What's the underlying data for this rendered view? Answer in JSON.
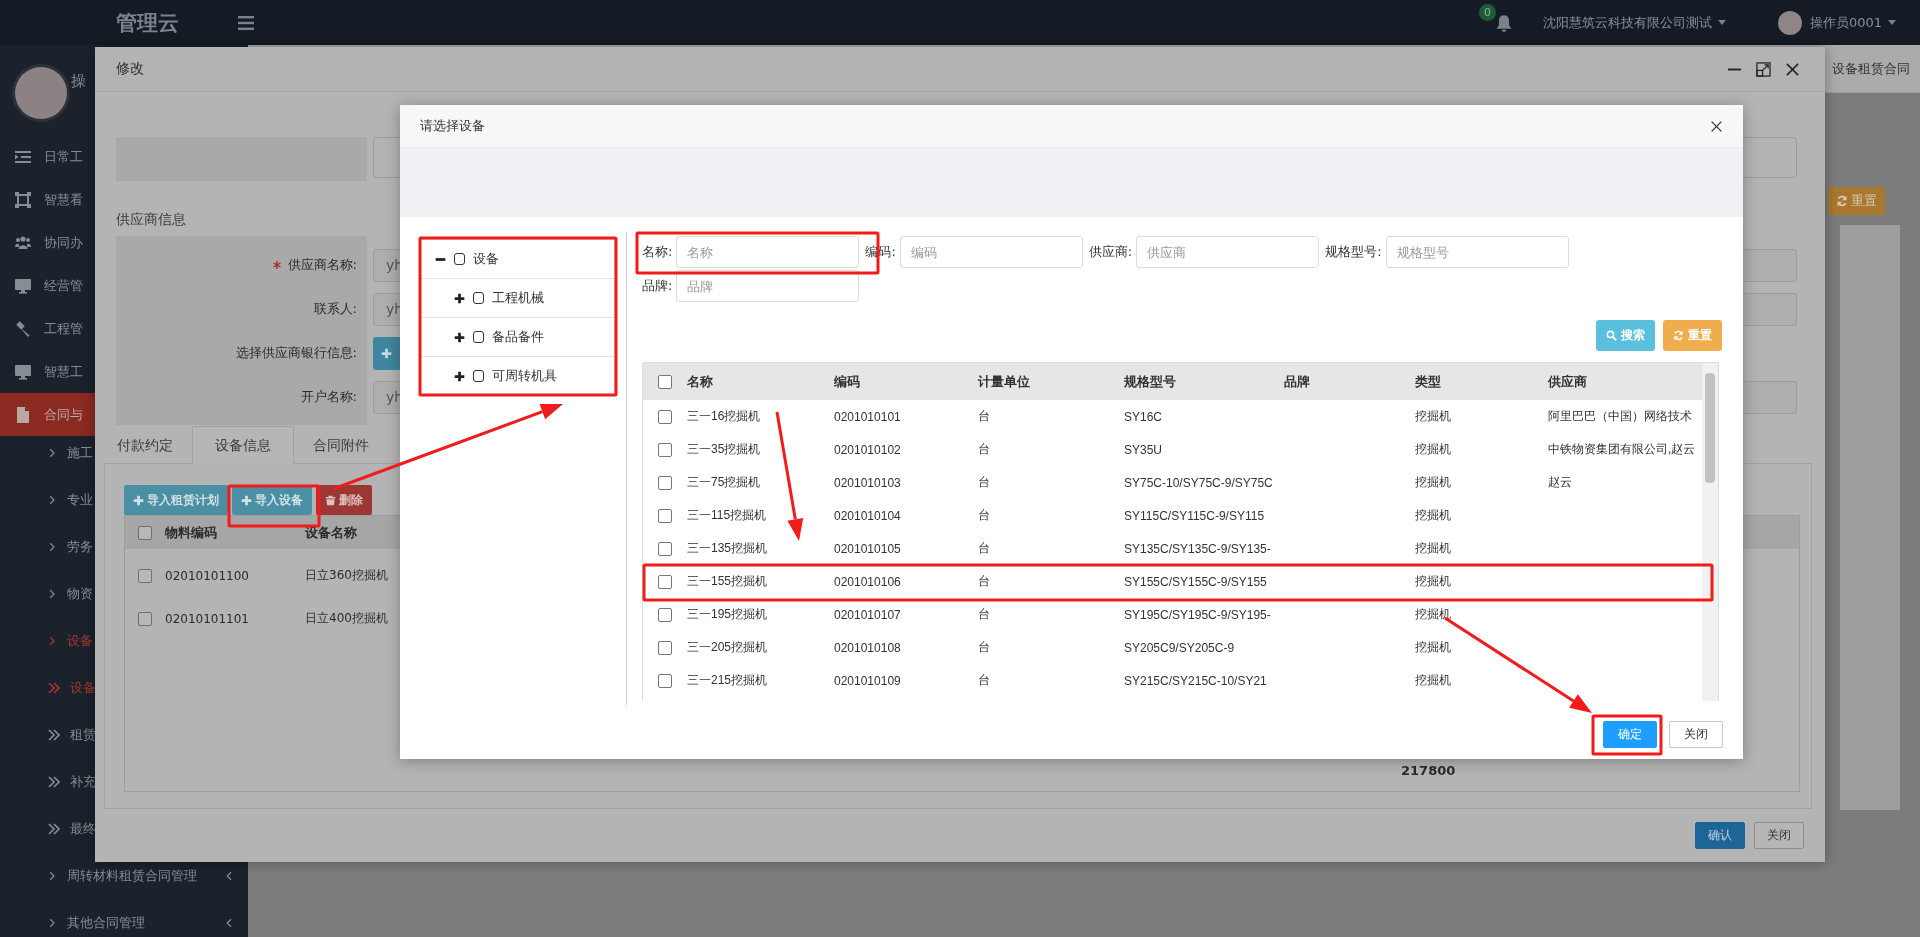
{
  "header": {
    "logo": "管理云",
    "notification_count": "0",
    "company": "沈阳慧筑云科技有限公司测试",
    "user": "操作员0001"
  },
  "sidebar": {
    "user_name": "操",
    "items": [
      {
        "label": "日常工",
        "kind": "section",
        "active": false,
        "collapsible": false
      },
      {
        "label": "智慧看",
        "kind": "section",
        "active": false,
        "collapsible": false
      },
      {
        "label": "协同办",
        "kind": "section",
        "active": false,
        "collapsible": false
      },
      {
        "label": "经营管",
        "kind": "section",
        "active": false,
        "collapsible": false
      },
      {
        "label": "工程管",
        "kind": "section",
        "active": false,
        "collapsible": false
      },
      {
        "label": "智慧工",
        "kind": "section",
        "active": false,
        "collapsible": false
      },
      {
        "label": "合同与",
        "kind": "section",
        "active": true,
        "collapsible": false
      },
      {
        "label": "施工",
        "kind": "link",
        "active": false,
        "collapsible": false
      },
      {
        "label": "专业",
        "kind": "link",
        "active": false,
        "collapsible": false
      },
      {
        "label": "劳务",
        "kind": "link",
        "active": false,
        "collapsible": false
      },
      {
        "label": "物资",
        "kind": "link",
        "active": false,
        "collapsible": false
      },
      {
        "label": "设备",
        "kind": "link",
        "active": true,
        "collapsible": false
      },
      {
        "label": "设备",
        "kind": "sublink",
        "active": true,
        "collapsible": false
      },
      {
        "label": "租赁",
        "kind": "sublink",
        "active": false,
        "collapsible": false
      },
      {
        "label": "补充",
        "kind": "sublink",
        "active": false,
        "collapsible": false
      },
      {
        "label": "最终",
        "kind": "sublink",
        "active": false,
        "collapsible": false
      },
      {
        "label": "周转材料租赁合同管理",
        "kind": "link",
        "active": false,
        "collapsible": true
      },
      {
        "label": "其他合同管理",
        "kind": "link",
        "active": false,
        "collapsible": true
      }
    ]
  },
  "background_page": {
    "tab": "设备租赁合同",
    "reset_button": "重置"
  },
  "edit_dialog": {
    "title": "修改",
    "section_title": "供应商信息",
    "fields": [
      {
        "label": "供应商名称:",
        "required": true,
        "kind": "input",
        "value": "yh"
      },
      {
        "label": "联系人:",
        "required": false,
        "kind": "input",
        "value": "yh"
      },
      {
        "label": "选择供应商银行信息:",
        "required": false,
        "kind": "button"
      },
      {
        "label": "开户名称:",
        "required": false,
        "kind": "input",
        "value": "yh"
      }
    ],
    "tabs": [
      {
        "label": "付款约定",
        "selected": false
      },
      {
        "label": "设备信息",
        "selected": true
      },
      {
        "label": "合同附件",
        "selected": false
      }
    ],
    "toolbar": [
      {
        "label": "导入租赁计划",
        "kind": "info"
      },
      {
        "label": "导入设备",
        "kind": "info"
      },
      {
        "label": "删除",
        "kind": "danger"
      }
    ],
    "table": {
      "all_checked": false,
      "columns": [
        "物料编码",
        "设备名称"
      ],
      "rows": [
        {
          "checked": false,
          "cells": [
            "02010101100",
            "日立360挖掘机"
          ]
        },
        {
          "checked": false,
          "cells": [
            "02010101101",
            "日立400挖掘机"
          ]
        }
      ],
      "total": "217800"
    },
    "buttons": [
      {
        "label": "确认",
        "kind": "primary"
      },
      {
        "label": "关闭",
        "kind": "default"
      }
    ]
  },
  "select_dialog": {
    "title": "请选择设备",
    "tree": [
      {
        "label": "设备",
        "checked": false,
        "expanded": true,
        "children": [
          {
            "label": "工程机械",
            "checked": false,
            "expanded": false
          },
          {
            "label": "备品备件",
            "checked": false,
            "expanded": false
          },
          {
            "label": "可周转机具",
            "checked": false,
            "expanded": false
          }
        ]
      }
    ],
    "filters": [
      {
        "label": "名称:",
        "placeholder": "名称"
      },
      {
        "label": "编码:",
        "placeholder": "编码"
      },
      {
        "label": "供应商:",
        "placeholder": "供应商"
      },
      {
        "label": "规格型号:",
        "placeholder": "规格型号"
      },
      {
        "label": "品牌:",
        "placeholder": "品牌"
      }
    ],
    "actions": [
      {
        "label": "搜索",
        "kind": "search"
      },
      {
        "label": "重置",
        "kind": "reset"
      }
    ],
    "table": {
      "all_checked": false,
      "columns": [
        "名称",
        "编码",
        "计量单位",
        "规格型号",
        "品牌",
        "类型",
        "供应商"
      ],
      "rows": [
        {
          "checked": false,
          "name": "三一16挖掘机",
          "code": "0201010101",
          "unit": "台",
          "spec": "SY16C",
          "type": "挖掘机",
          "supplier": "阿里巴巴（中国）网络技术"
        },
        {
          "checked": false,
          "name": "三一35挖掘机",
          "code": "0201010102",
          "unit": "台",
          "spec": "SY35U",
          "type": "挖掘机",
          "supplier": "中铁物资集团有限公司,赵云"
        },
        {
          "checked": false,
          "name": "三一75挖掘机",
          "code": "0201010103",
          "unit": "台",
          "spec": "SY75C-10/SY75C-9/SY75C",
          "type": "挖掘机",
          "supplier": "赵云"
        },
        {
          "checked": false,
          "name": "三一115挖掘机",
          "code": "0201010104",
          "unit": "台",
          "spec": "SY115C/SY115C-9/SY115",
          "type": "挖掘机"
        },
        {
          "checked": false,
          "name": "三一135挖掘机",
          "code": "0201010105",
          "unit": "台",
          "spec": "SY135C/SY135C-9/SY135-",
          "type": "挖掘机"
        },
        {
          "checked": false,
          "name": "三一155挖掘机",
          "code": "0201010106",
          "unit": "台",
          "spec": "SY155C/SY155C-9/SY155",
          "type": "挖掘机"
        },
        {
          "checked": false,
          "name": "三一195挖掘机",
          "code": "0201010107",
          "unit": "台",
          "spec": "SY195C/SY195C-9/SY195-",
          "type": "挖掘机"
        },
        {
          "checked": false,
          "name": "三一205挖掘机",
          "code": "0201010108",
          "unit": "台",
          "spec": "SY205C9/SY205C-9",
          "type": "挖掘机"
        },
        {
          "checked": false,
          "name": "三一215挖掘机",
          "code": "0201010109",
          "unit": "台",
          "spec": "SY215C/SY215C-10/SY21",
          "type": "挖掘机"
        }
      ]
    },
    "buttons": [
      {
        "label": "确定",
        "kind": "primary"
      },
      {
        "label": "关闭",
        "kind": "default"
      }
    ]
  }
}
